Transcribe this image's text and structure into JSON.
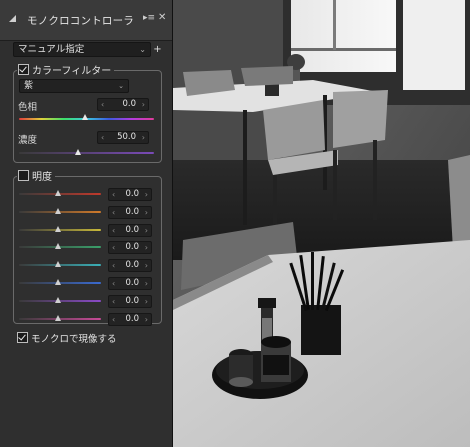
{
  "panel": {
    "title": "モノクロコントローラ",
    "preset_value": "マニュアル指定",
    "add_button": "+",
    "color_filter": {
      "label": "カラーフィルター",
      "checked": true,
      "color_value": "紫",
      "hue": {
        "label": "色相",
        "value": "0.0",
        "slider": 0.5
      },
      "density": {
        "label": "濃度",
        "value": "50.0",
        "slider": 0.5
      }
    },
    "brightness": {
      "label": "明度",
      "checked": false,
      "rows": [
        {
          "color": "#c0392b",
          "value": "0.0"
        },
        {
          "color": "#d07a2a",
          "value": "0.0"
        },
        {
          "color": "#c8b93a",
          "value": "0.0"
        },
        {
          "color": "#3aa06a",
          "value": "0.0"
        },
        {
          "color": "#3ab0b8",
          "value": "0.0"
        },
        {
          "color": "#3a6ad0",
          "value": "0.0"
        },
        {
          "color": "#8a4ac8",
          "value": "0.0"
        },
        {
          "color": "#c84a98",
          "value": "0.0"
        }
      ]
    },
    "monochrome_label": "モノクロで現像する",
    "monochrome_checked": true
  }
}
